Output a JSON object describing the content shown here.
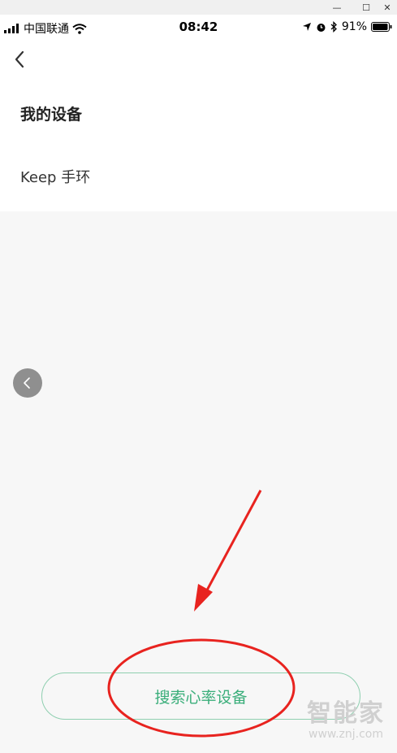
{
  "statusbar": {
    "carrier": "中国联通",
    "time": "08:42",
    "battery": "91%"
  },
  "page": {
    "title": "我的设备",
    "device_name": "Keep 手环",
    "search_button_label": "搜索心率设备"
  },
  "watermark": {
    "text": "智能家",
    "url": "www.znj.com"
  },
  "colors": {
    "accent": "#3aae7a",
    "annotation": "#e8231f"
  }
}
